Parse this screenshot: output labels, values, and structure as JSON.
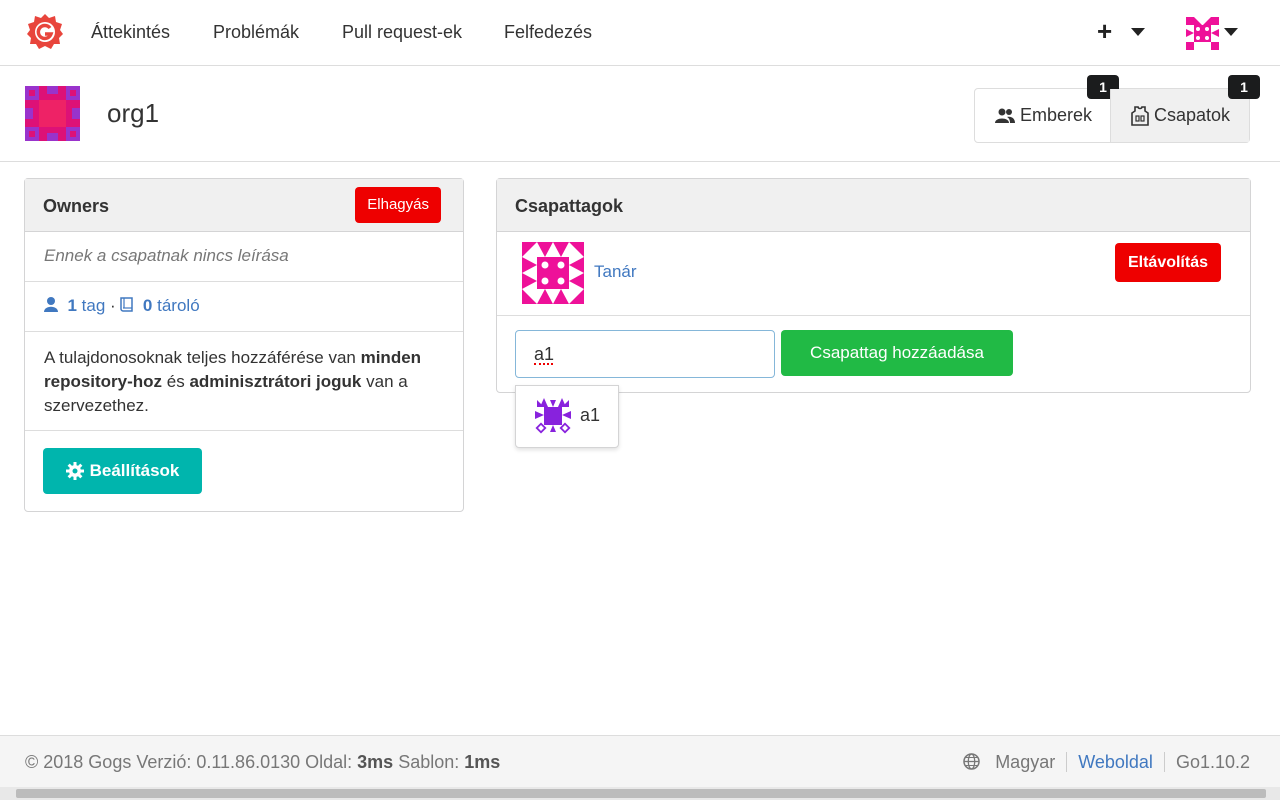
{
  "nav": {
    "items": [
      "Áttekintés",
      "Problémák",
      "Pull request-ek",
      "Felfedezés"
    ],
    "plus_label": "+"
  },
  "org": {
    "name": "org1",
    "tabs": [
      {
        "label": "Emberek",
        "count": "1"
      },
      {
        "label": "Csapatok",
        "count": "1"
      }
    ]
  },
  "team": {
    "name": "Owners",
    "leave_label": "Elhagyás",
    "description": "Ennek a csapatnak nincs leírása",
    "members_count": "1",
    "members_label": "tag",
    "separator": "·",
    "repos_count": "0",
    "repos_label": "tároló",
    "info_parts": [
      "A tulajdonosoknak teljes hozzáférése van ",
      "minden repository-hoz",
      " és ",
      "adminisztrátori joguk",
      " van a szervezethez."
    ],
    "settings_label": "Beállítások"
  },
  "members": {
    "title": "Csapattagok",
    "list": [
      {
        "name": "Tanár",
        "remove_label": "Eltávolítás"
      }
    ],
    "input_value": "a1",
    "add_label": "Csapattag hozzáadása",
    "suggestion": "a1"
  },
  "footer": {
    "left_prefix": "© 2018 Gogs Verzió: 0.11.86.0130 Oldal: ",
    "page_time": "3ms",
    "template_label": " Sablon: ",
    "template_time": "1ms",
    "language": "Magyar",
    "website": "Weboldal",
    "go_version": "Go1.10.2"
  },
  "colors": {
    "danger": "#ee0000",
    "teal": "#00b5ad",
    "green": "#21ba45",
    "link": "#4078c0",
    "logo": "#e8453c"
  }
}
